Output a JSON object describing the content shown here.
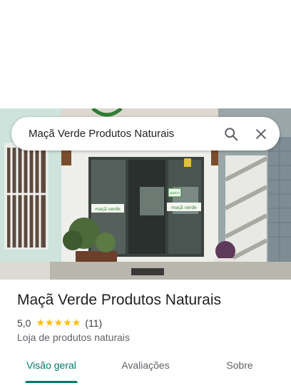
{
  "search": {
    "query": "Maçã Verde Produtos Naturais",
    "search_icon": "search-icon",
    "close_icon": "close-icon"
  },
  "place": {
    "name": "Maçã Verde Produtos Naturais",
    "rating": "5,0",
    "stars_filled": 5,
    "review_count": "(11)",
    "category": "Loja de produtos naturais"
  },
  "storefront": {
    "logo_sign_left": "maçã verde",
    "logo_sign_right": "maçã verde",
    "door_sign": "ABERTO"
  },
  "tabs": [
    {
      "label": "Visão geral",
      "active": true
    },
    {
      "label": "Avaliações",
      "active": false
    },
    {
      "label": "Sobre",
      "active": false
    }
  ],
  "colors": {
    "accent": "#00796b",
    "star": "#fbbc04"
  }
}
